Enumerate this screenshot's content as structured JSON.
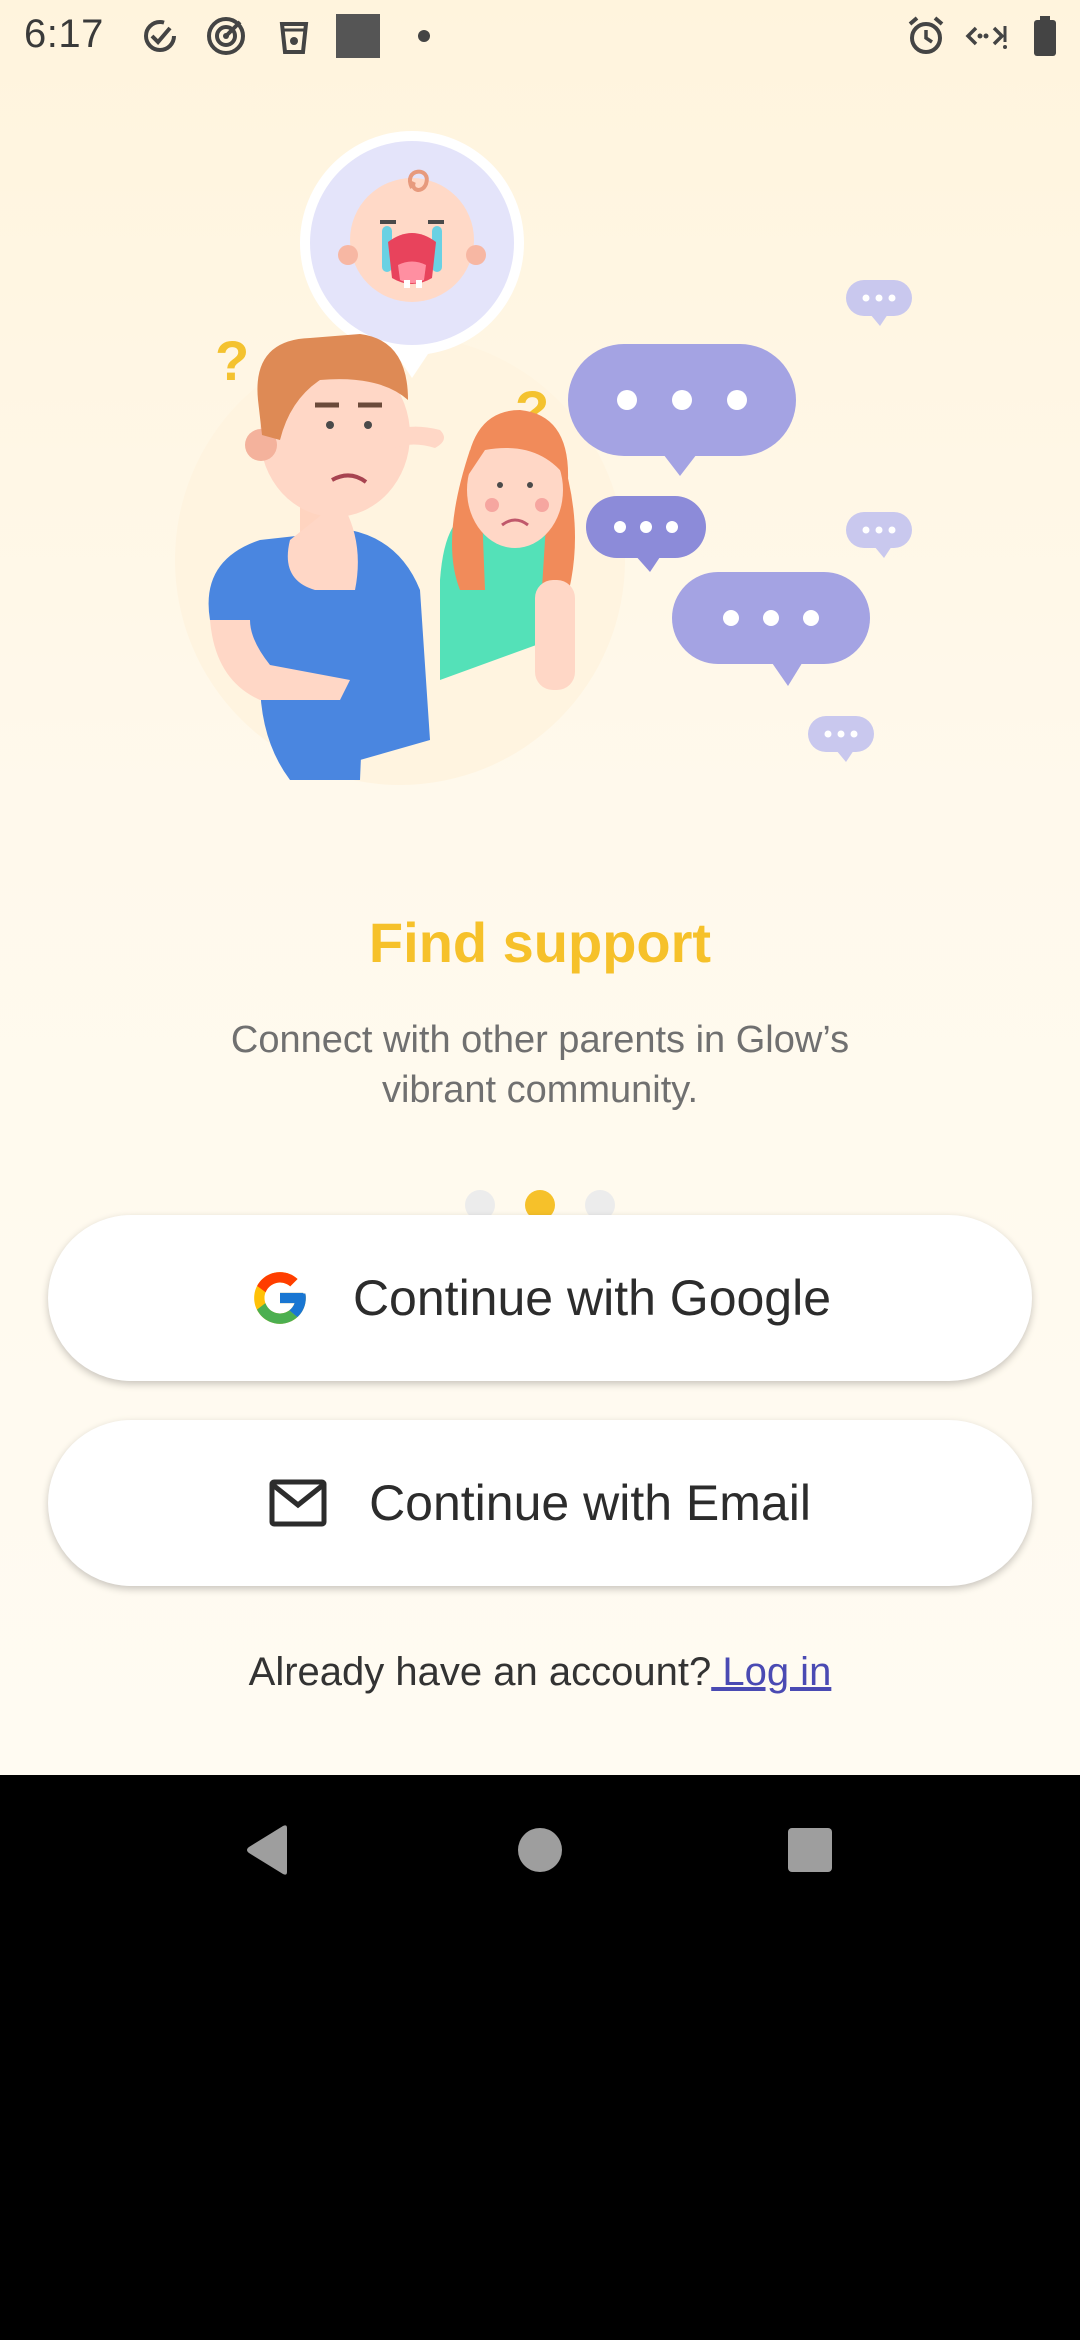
{
  "status_bar": {
    "time": "6:17",
    "left_icons": [
      "check-circle-icon",
      "target-icon",
      "trash-icon",
      "square-icon",
      "dot-icon"
    ],
    "right_icons": [
      "alarm-icon",
      "data-saver-icon",
      "battery-icon"
    ]
  },
  "onboarding": {
    "title": "Find support",
    "subtitle": "Connect with other parents in Glow’s vibrant community.",
    "page_count": 3,
    "active_page": 2
  },
  "buttons": {
    "google_label": "Continue with Google",
    "email_label": "Continue with Email"
  },
  "login": {
    "prompt": "Already have an account?",
    "link": " Log in"
  },
  "colors": {
    "accent": "#f6c12a",
    "link": "#4a4ab3",
    "bubble": "#a4a3e3",
    "bubble_dark": "#8c8bd9",
    "bubble_light": "#c9c8ee"
  },
  "nav": {
    "icons": [
      "back-icon",
      "home-icon",
      "recents-icon"
    ]
  }
}
